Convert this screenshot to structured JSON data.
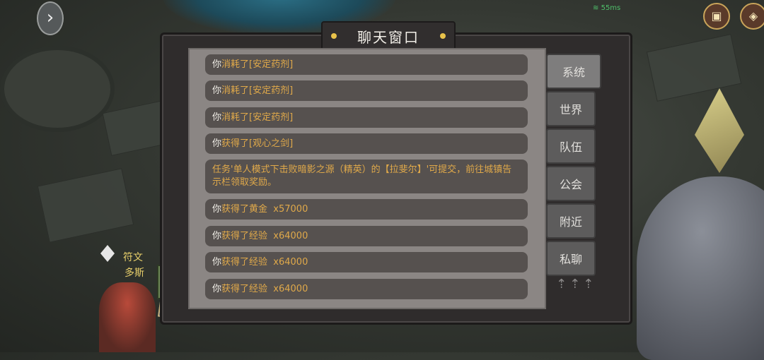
{
  "window": {
    "title": "聊天窗口"
  },
  "status": {
    "network": "55ms"
  },
  "hud": {
    "rune_label_1": "符文",
    "rune_label_2": "多斯"
  },
  "chat": {
    "messages": [
      {
        "prefix": "你",
        "verb": "消耗了",
        "item": "[安定药剂]"
      },
      {
        "prefix": "你",
        "verb": "消耗了",
        "item": "[安定药剂]"
      },
      {
        "prefix": "你",
        "verb": "消耗了",
        "item": "[安定药剂]"
      },
      {
        "prefix": "你",
        "verb": "获得了",
        "item": "[观心之剑]"
      },
      {
        "text": "任务'单人模式下击败暗影之源（精英）的【拉斐尔】'可提交，前往城镇告示栏领取奖励。"
      },
      {
        "prefix": "你",
        "verb": "获得了黄金",
        "amount": "x57000"
      },
      {
        "prefix": "你",
        "verb": "获得了经验",
        "amount": "x64000"
      },
      {
        "prefix": "你",
        "verb": "获得了经验",
        "amount": "x64000"
      },
      {
        "prefix": "你",
        "verb": "获得了经验",
        "amount": "x64000"
      }
    ]
  },
  "tabs": [
    {
      "label": "系统",
      "active": true
    },
    {
      "label": "世界"
    },
    {
      "label": "队伍"
    },
    {
      "label": "公会"
    },
    {
      "label": "附近"
    },
    {
      "label": "私聊"
    }
  ],
  "colors": {
    "highlight": "#e0a94a",
    "panel": "#8b8684",
    "bubble": "#56514f"
  }
}
